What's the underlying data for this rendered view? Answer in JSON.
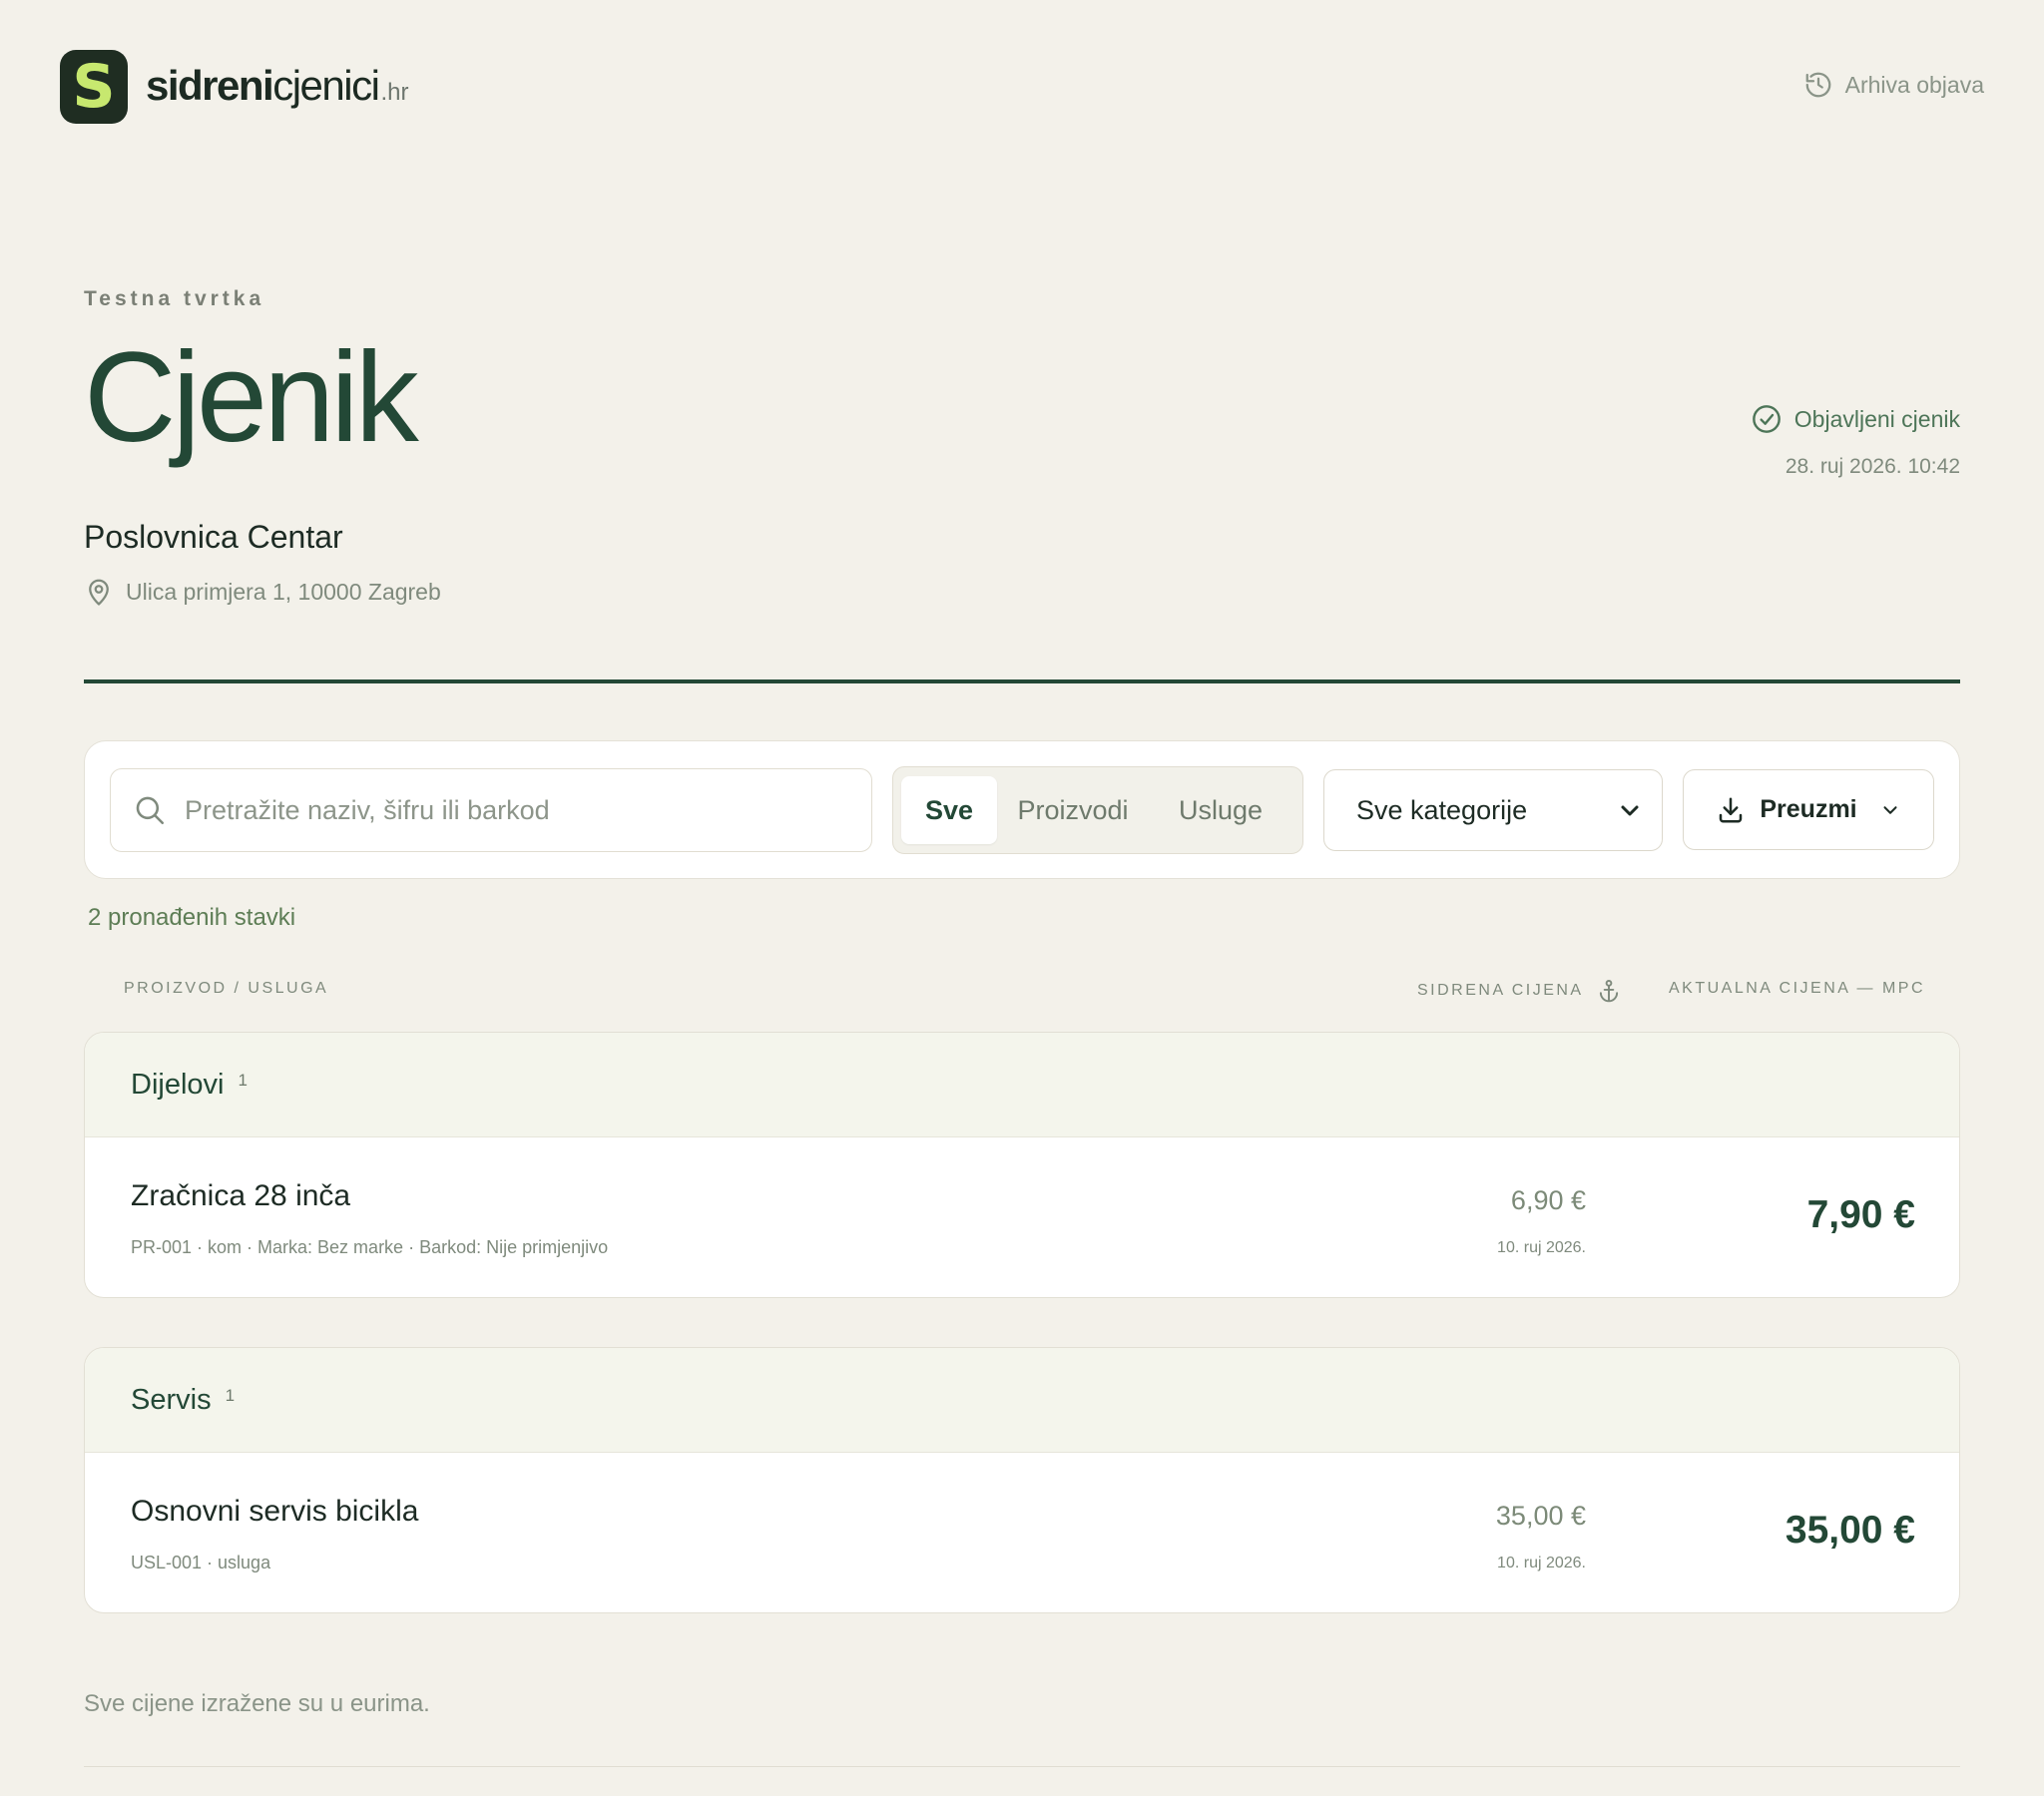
{
  "header": {
    "logo_glyph": "S",
    "logo_bold": "sidreni",
    "logo_normal": "cjenici",
    "logo_suffix": ".hr",
    "archive_label": "Arhiva objava",
    "archive_icon": "history-icon"
  },
  "page": {
    "company": "Testna tvrtka",
    "title": "Cjenik",
    "branch": "Poslovnica Centar",
    "address": "Ulica primjera 1, 10000 Zagreb",
    "status_label": "Objavljeni cjenik",
    "status_date": "28. ruj 2026. 10:42"
  },
  "toolbar": {
    "search_placeholder": "Pretražite naziv, šifru ili barkod",
    "filters": [
      {
        "label": "Sve",
        "active": true
      },
      {
        "label": "Proizvodi",
        "active": false
      },
      {
        "label": "Usluge",
        "active": false
      }
    ],
    "category_select": "Sve kategorije",
    "download_label": "Preuzmi"
  },
  "results": {
    "count_label": "2 pronađenih stavki",
    "columns": {
      "product": "Proizvod / usluga",
      "anchor": "Sidrena cijena",
      "current": "Aktualna cijena — MPC"
    }
  },
  "groups": [
    {
      "title": "Dijelovi",
      "count": "1",
      "items": [
        {
          "name": "Zračnica 28 inča",
          "meta": "PR-001 · kom · Marka: Bez marke · Barkod: Nije primjenjivo",
          "anchor_price": "6,90 €",
          "anchor_date": "10. ruj 2026.",
          "current_price": "7,90 €"
        }
      ]
    },
    {
      "title": "Servis",
      "count": "1",
      "items": [
        {
          "name": "Osnovni servis bicikla",
          "meta": "USL-001 · usluga",
          "anchor_price": "35,00 €",
          "anchor_date": "10. ruj 2026.",
          "current_price": "35,00 €"
        }
      ]
    }
  ],
  "footer": {
    "note": "Sve cijene izražene su u eurima."
  },
  "colors": {
    "background": "#f3f1ea",
    "brand_dark": "#234836",
    "logo_bg": "#1f2d22",
    "logo_accent": "#c7e86f",
    "muted_green": "#5d7d55"
  }
}
